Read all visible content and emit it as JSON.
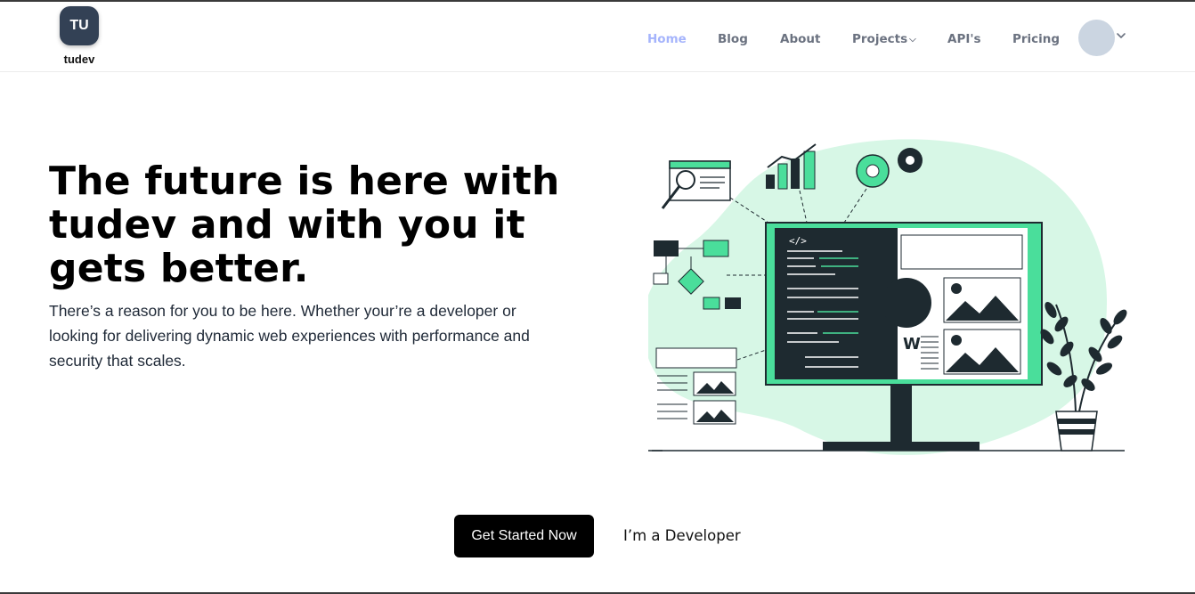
{
  "brand": {
    "initials": "TU",
    "name": "tudev"
  },
  "nav": {
    "items": [
      {
        "label": "Home",
        "active": true
      },
      {
        "label": "Blog"
      },
      {
        "label": "About"
      },
      {
        "label": "Projects",
        "has_dropdown": true
      },
      {
        "label": "API's"
      },
      {
        "label": "Pricing"
      }
    ]
  },
  "hero": {
    "title": "The future is here with tudev and with you it gets better.",
    "description": "There’s a reason for you to be here. Whether your’re a developer or looking for delivering dynamic web experiences with performance and security that scales."
  },
  "cta": {
    "primary_label": "Get Started Now",
    "secondary_label": "I’m a Developer"
  },
  "colors": {
    "logo_bg": "#334155",
    "nav_active": "#a5b4fc",
    "nav_text": "#6b7280",
    "accent_green": "#4ade9b",
    "blob_green": "#d7f7e6",
    "dark": "#1e2a30"
  },
  "icons": [
    "chevron-down-icon",
    "avatar",
    "illustration"
  ]
}
